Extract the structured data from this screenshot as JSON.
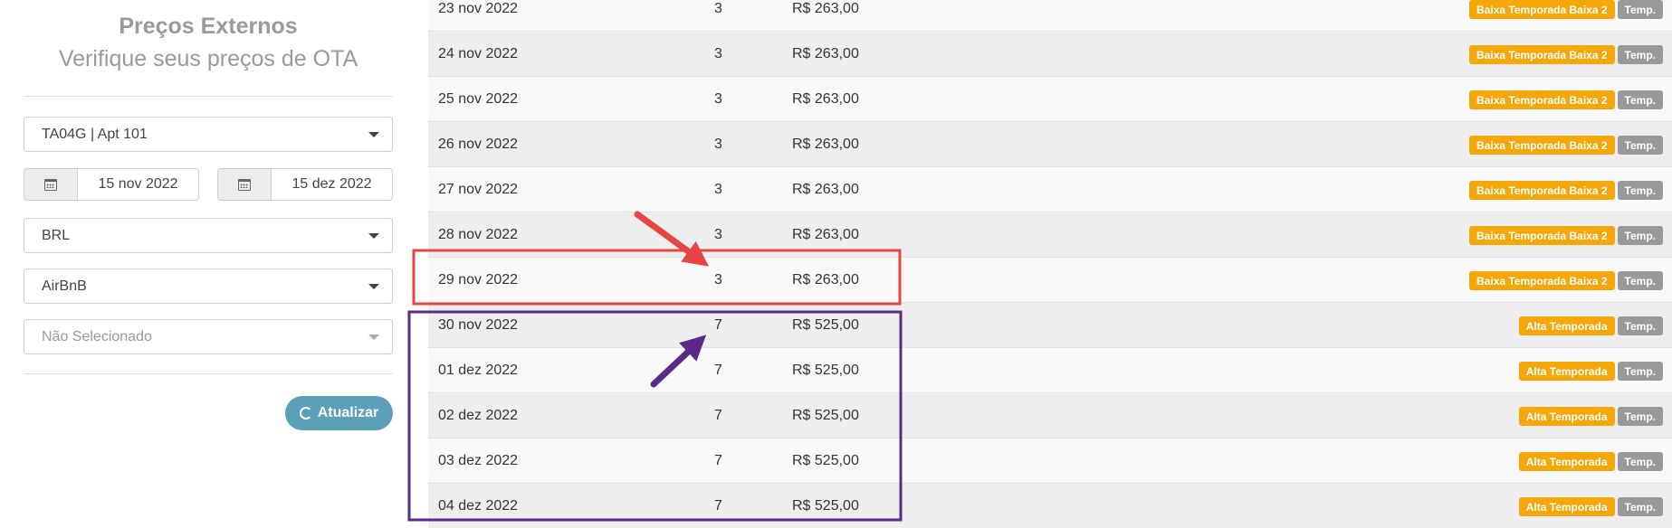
{
  "sidebar": {
    "title": "Preços Externos",
    "subtitle": "Verifique seus preços de OTA",
    "property_select": "TA04G | Apt 101",
    "start_date": "15 nov 2022",
    "end_date": "15 dez 2022",
    "currency_select": "BRL",
    "channel_select": "AirBnB",
    "extra_select_placeholder": "Não Selecionado",
    "update_button": "Atualizar",
    "icons": {
      "calendar": "calendar-icon",
      "caret": "chevron-down-icon",
      "refresh": "refresh-icon"
    }
  },
  "table": {
    "rows": [
      {
        "date": "23 nov 2022",
        "nights": "3",
        "price": "R$ 263,00",
        "season": "Baixa Temporada Baixa 2",
        "tag": "Temp."
      },
      {
        "date": "24 nov 2022",
        "nights": "3",
        "price": "R$ 263,00",
        "season": "Baixa Temporada Baixa 2",
        "tag": "Temp."
      },
      {
        "date": "25 nov 2022",
        "nights": "3",
        "price": "R$ 263,00",
        "season": "Baixa Temporada Baixa 2",
        "tag": "Temp."
      },
      {
        "date": "26 nov 2022",
        "nights": "3",
        "price": "R$ 263,00",
        "season": "Baixa Temporada Baixa 2",
        "tag": "Temp."
      },
      {
        "date": "27 nov 2022",
        "nights": "3",
        "price": "R$ 263,00",
        "season": "Baixa Temporada Baixa 2",
        "tag": "Temp."
      },
      {
        "date": "28 nov 2022",
        "nights": "3",
        "price": "R$ 263,00",
        "season": "Baixa Temporada Baixa 2",
        "tag": "Temp."
      },
      {
        "date": "29 nov 2022",
        "nights": "3",
        "price": "R$ 263,00",
        "season": "Baixa Temporada Baixa 2",
        "tag": "Temp."
      },
      {
        "date": "30 nov 2022",
        "nights": "7",
        "price": "R$ 525,00",
        "season": "Alta Temporada",
        "tag": "Temp."
      },
      {
        "date": "01 dez 2022",
        "nights": "7",
        "price": "R$ 525,00",
        "season": "Alta Temporada",
        "tag": "Temp."
      },
      {
        "date": "02 dez 2022",
        "nights": "7",
        "price": "R$ 525,00",
        "season": "Alta Temporada",
        "tag": "Temp."
      },
      {
        "date": "03 dez 2022",
        "nights": "7",
        "price": "R$ 525,00",
        "season": "Alta Temporada",
        "tag": "Temp."
      },
      {
        "date": "04 dez 2022",
        "nights": "7",
        "price": "R$ 525,00",
        "season": "Alta Temporada",
        "tag": "Temp."
      }
    ]
  },
  "colors": {
    "season_badge": "#f5a70a",
    "temp_badge": "#999999",
    "update_button": "#5c9fb9",
    "annotation_red": "#e84444",
    "annotation_purple": "#5a2a8a"
  }
}
